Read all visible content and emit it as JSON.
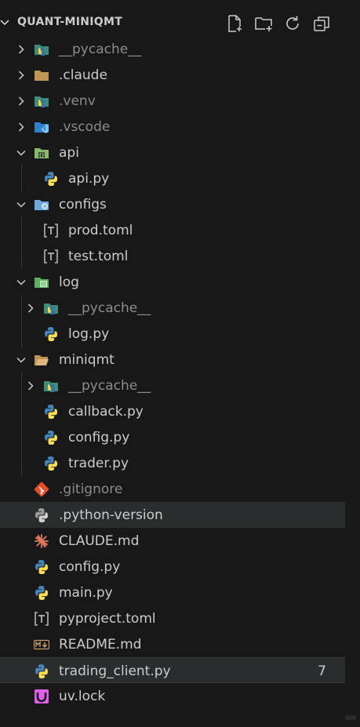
{
  "explorer": {
    "title": "QUANT-MINIQMT",
    "actions": [
      "new-file-icon",
      "new-folder-icon",
      "refresh-icon",
      "collapse-all-icon"
    ]
  },
  "tree": [
    {
      "label": "__pycache__",
      "dim": true,
      "kind": "folder",
      "expanded": false,
      "depth": 0,
      "icon": "python-folder-icon"
    },
    {
      "label": ".claude",
      "dim": false,
      "kind": "folder",
      "expanded": false,
      "depth": 0,
      "icon": "folder-icon"
    },
    {
      "label": ".venv",
      "dim": true,
      "kind": "folder",
      "expanded": false,
      "depth": 0,
      "icon": "python-folder-icon"
    },
    {
      "label": ".vscode",
      "dim": true,
      "kind": "folder",
      "expanded": false,
      "depth": 0,
      "icon": "vscode-folder-icon"
    },
    {
      "label": "api",
      "dim": false,
      "kind": "folder",
      "expanded": true,
      "depth": 0,
      "icon": "api-folder-icon"
    },
    {
      "label": "api.py",
      "dim": false,
      "kind": "file",
      "depth": 1,
      "icon": "python-file-icon"
    },
    {
      "label": "configs",
      "dim": false,
      "kind": "folder",
      "expanded": true,
      "depth": 0,
      "icon": "config-folder-icon"
    },
    {
      "label": "prod.toml",
      "dim": false,
      "kind": "file",
      "depth": 1,
      "icon": "toml-file-icon"
    },
    {
      "label": "test.toml",
      "dim": false,
      "kind": "file",
      "depth": 1,
      "icon": "toml-file-icon"
    },
    {
      "label": "log",
      "dim": false,
      "kind": "folder",
      "expanded": true,
      "depth": 0,
      "icon": "log-folder-icon"
    },
    {
      "label": "__pycache__",
      "dim": true,
      "kind": "folder",
      "expanded": false,
      "depth": 1,
      "icon": "python-folder-icon"
    },
    {
      "label": "log.py",
      "dim": false,
      "kind": "file",
      "depth": 1,
      "icon": "python-file-icon"
    },
    {
      "label": "miniqmt",
      "dim": false,
      "kind": "folder",
      "expanded": true,
      "depth": 0,
      "icon": "folder-open-icon"
    },
    {
      "label": "__pycache__",
      "dim": true,
      "kind": "folder",
      "expanded": false,
      "depth": 1,
      "icon": "python-folder-icon"
    },
    {
      "label": "callback.py",
      "dim": false,
      "kind": "file",
      "depth": 1,
      "icon": "python-file-icon"
    },
    {
      "label": "config.py",
      "dim": false,
      "kind": "file",
      "depth": 1,
      "icon": "python-file-icon"
    },
    {
      "label": "trader.py",
      "dim": false,
      "kind": "file",
      "depth": 1,
      "icon": "python-file-icon"
    },
    {
      "label": ".gitignore",
      "dim": true,
      "kind": "file",
      "depth": 0,
      "icon": "git-icon"
    },
    {
      "label": ".python-version",
      "dim": false,
      "kind": "file",
      "depth": 0,
      "icon": "python-gray-icon",
      "state": "hover"
    },
    {
      "label": "CLAUDE.md",
      "dim": false,
      "kind": "file",
      "depth": 0,
      "icon": "claude-icon"
    },
    {
      "label": "config.py",
      "dim": false,
      "kind": "file",
      "depth": 0,
      "icon": "python-file-icon"
    },
    {
      "label": "main.py",
      "dim": false,
      "kind": "file",
      "depth": 0,
      "icon": "python-file-icon"
    },
    {
      "label": "pyproject.toml",
      "dim": false,
      "kind": "file",
      "depth": 0,
      "icon": "toml-file-icon"
    },
    {
      "label": "README.md",
      "dim": false,
      "kind": "file",
      "depth": 0,
      "icon": "markdown-icon"
    },
    {
      "label": "trading_client.py",
      "dim": false,
      "kind": "file",
      "depth": 0,
      "icon": "python-file-icon",
      "state": "selected",
      "badge": "7"
    },
    {
      "label": "uv.lock",
      "dim": false,
      "kind": "file",
      "depth": 0,
      "icon": "uv-lock-icon"
    }
  ]
}
